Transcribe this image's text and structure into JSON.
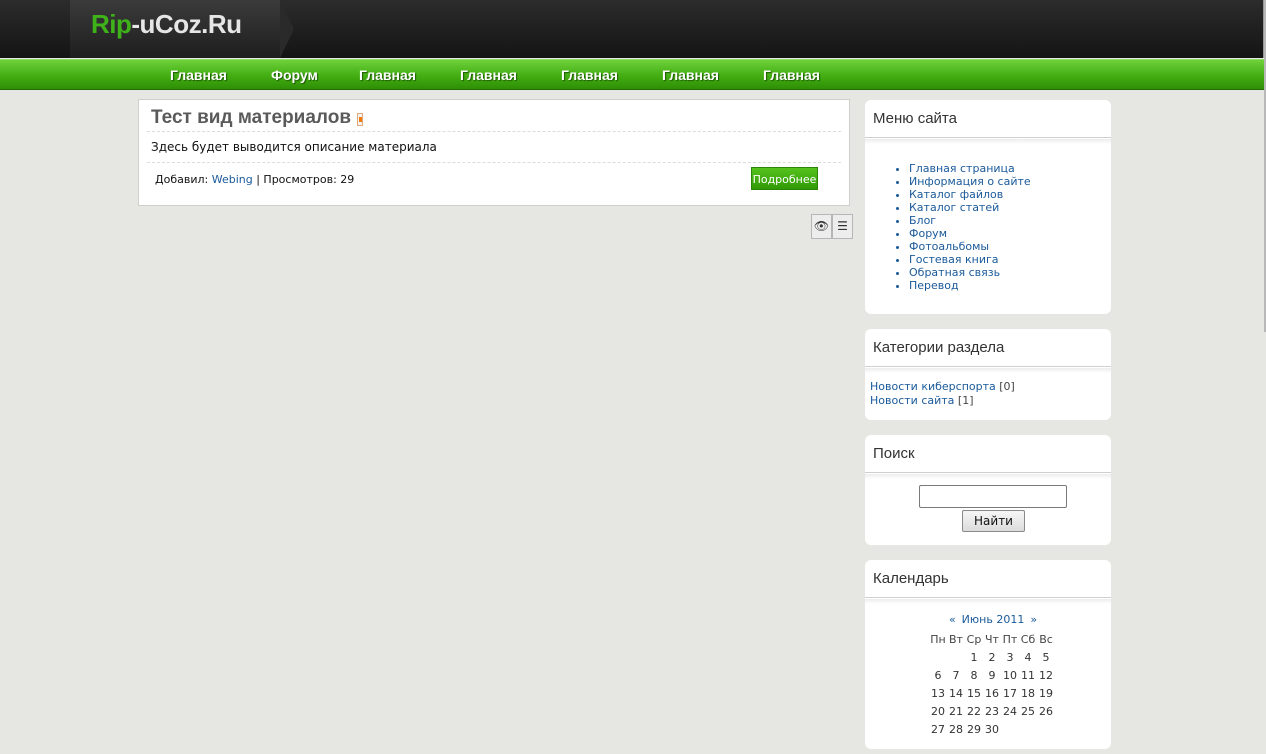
{
  "header": {
    "logo_accent": "Rip",
    "logo_rest": "-uCoz.Ru"
  },
  "nav": {
    "items": [
      "Главная",
      "Форум",
      "Главная",
      "Главная",
      "Главная",
      "Главная",
      "Главная"
    ]
  },
  "entry": {
    "title": "Тест вид материалов",
    "description": "Здесь будет выводится описание материала",
    "added_by_label": "Добавил:",
    "author": "Webing",
    "views_label": "| Просмотров: 29",
    "more_button": "Подробнее"
  },
  "view_buttons": {
    "icons": [
      "eye-icon",
      "list-icon"
    ]
  },
  "site_menu": {
    "title": "Меню сайта",
    "items": [
      "Главная страница",
      "Информация о сайте",
      "Каталог файлов",
      "Каталог статей",
      "Блог",
      "Форум",
      "Фотоальбомы",
      "Гостевая книга",
      "Обратная связь",
      "Перевод"
    ]
  },
  "categories": {
    "title": "Категории раздела",
    "items": [
      {
        "name": "Новости киберспорта",
        "count": "[0]"
      },
      {
        "name": "Новости сайта",
        "count": "[1]"
      }
    ]
  },
  "search": {
    "title": "Поиск",
    "input_value": "",
    "button": "Найти"
  },
  "calendar": {
    "title": "Календарь",
    "prev": "«",
    "month": "Июнь 2011",
    "next": "»",
    "weekdays": [
      "Пн",
      "Вт",
      "Ср",
      "Чт",
      "Пт",
      "Сб",
      "Вс"
    ],
    "weeks": [
      [
        "",
        "",
        "",
        "1",
        "2",
        "3",
        "4",
        "5"
      ],
      [
        "6",
        "7",
        "8",
        "9",
        "10",
        "11",
        "12"
      ],
      [
        "13",
        "14",
        "15",
        "16",
        "17",
        "18",
        "19"
      ],
      [
        "20",
        "21",
        "22",
        "23",
        "24",
        "25",
        "26"
      ],
      [
        "27",
        "28",
        "29",
        "30",
        "",
        "",
        ""
      ]
    ]
  }
}
